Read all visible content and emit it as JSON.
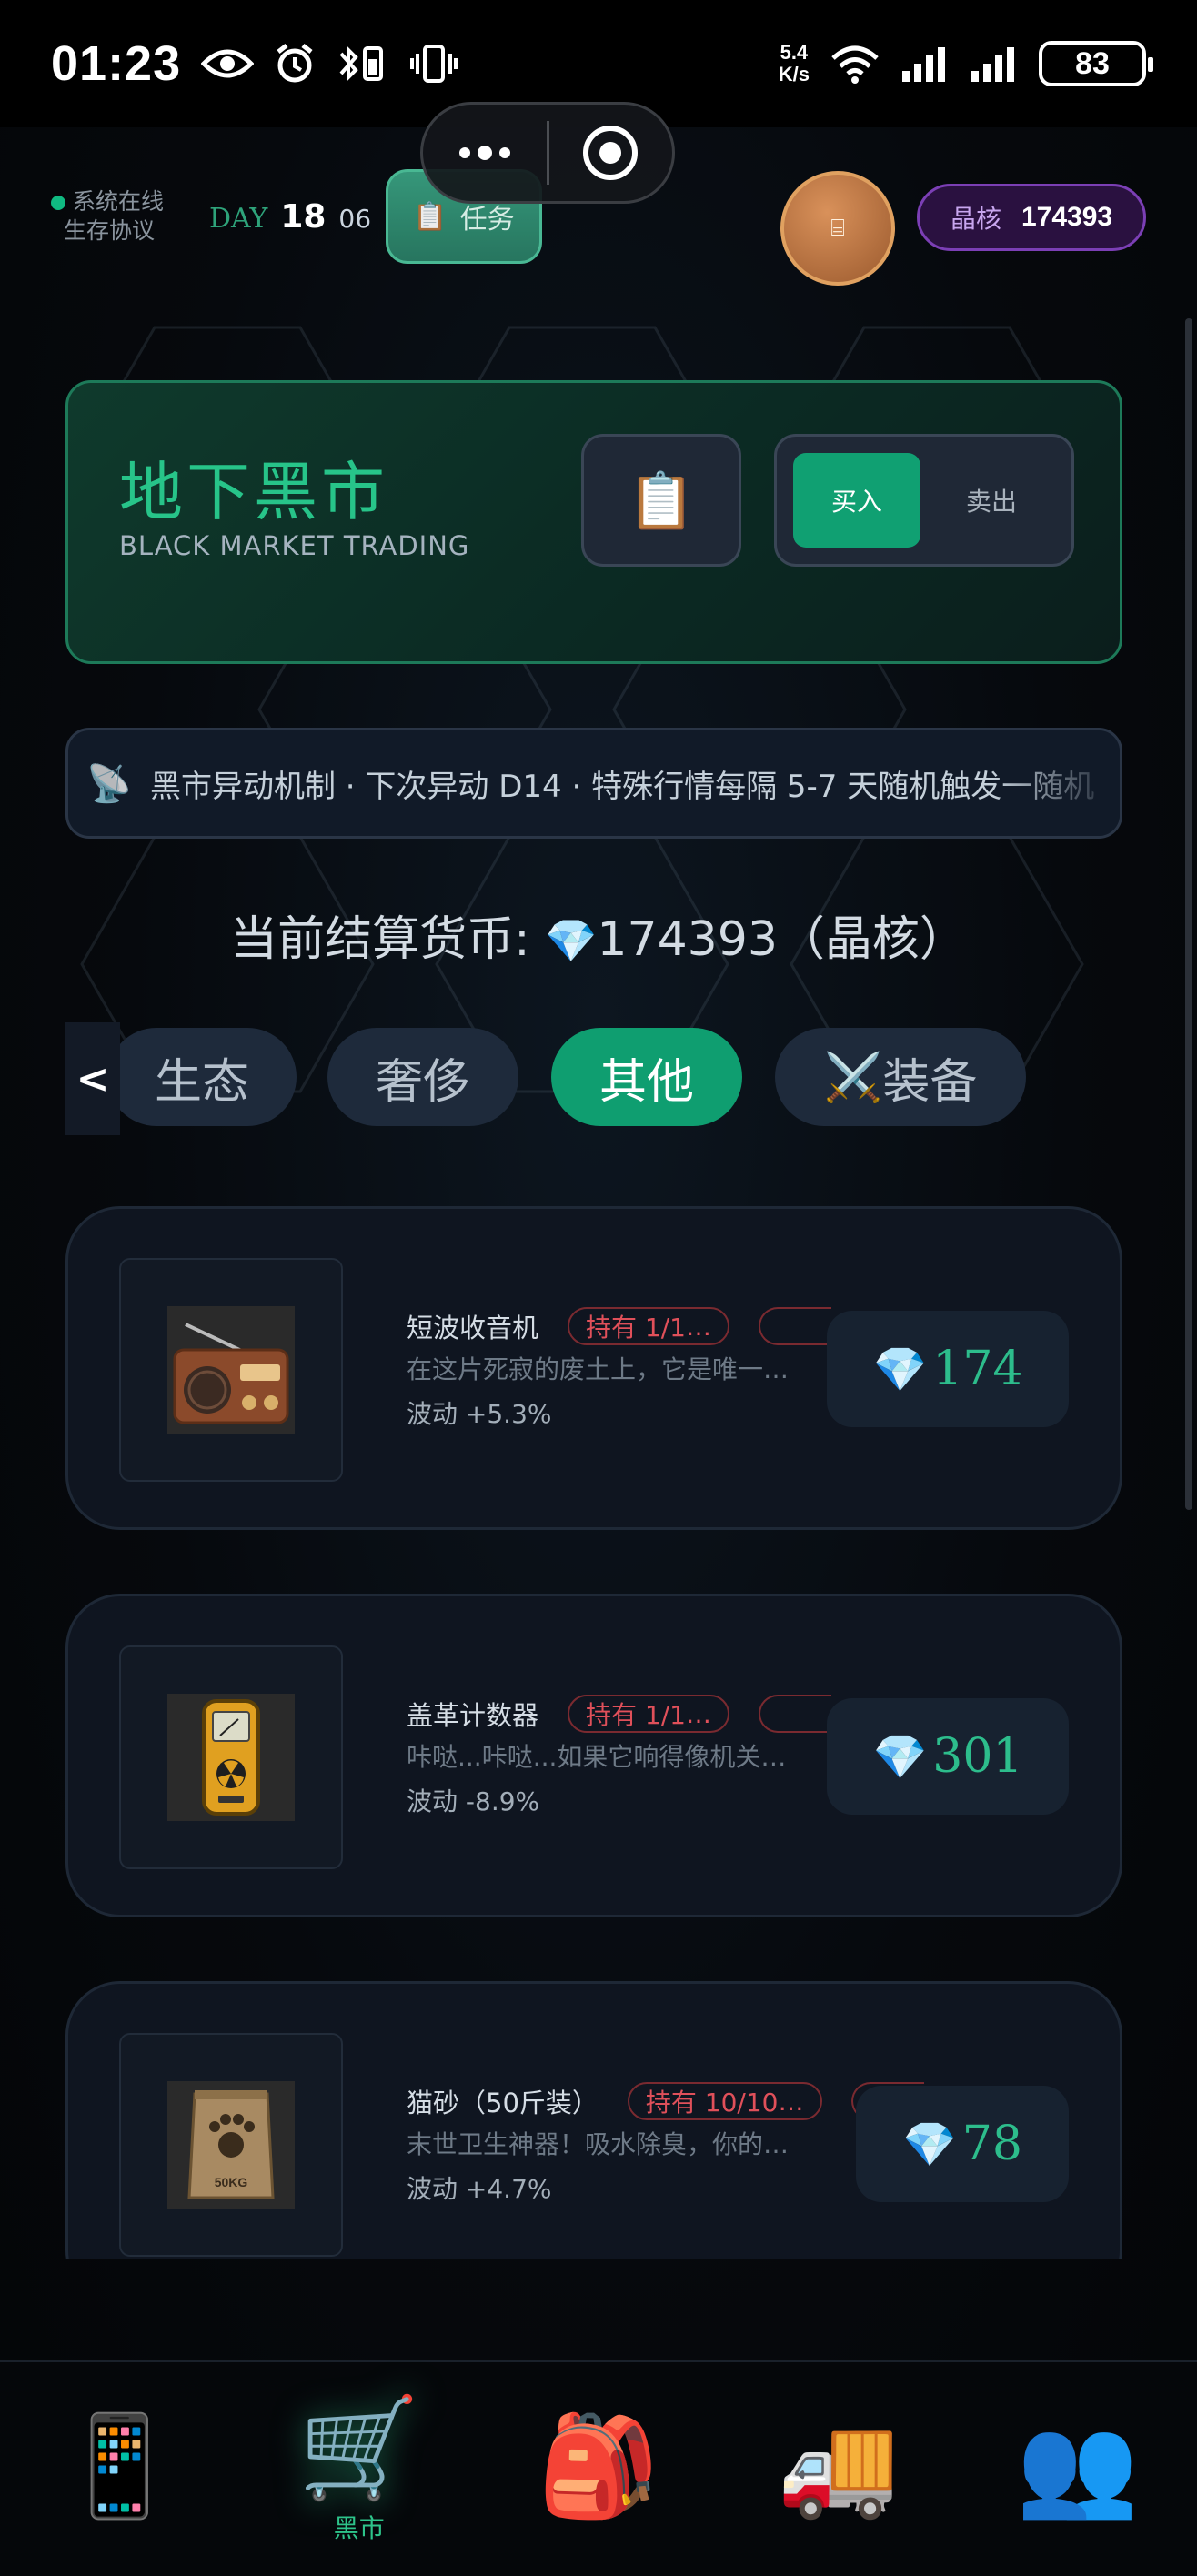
{
  "status_bar": {
    "time": "01:23",
    "net_speed_value": "5.4",
    "net_speed_unit": "K/s",
    "battery": "83"
  },
  "header": {
    "online_status": "系统在线",
    "protocol": "生存协议",
    "day_label": "DAY",
    "day_number": "18",
    "day_sub": "06",
    "task_button": "任务",
    "avatar_glyph": "⌸",
    "crystal_label": "晶核",
    "crystal_value": "174393"
  },
  "market": {
    "title": "地下黑市",
    "subtitle": "BLACK MARKET TRADING",
    "mode_buy": "买入",
    "mode_sell": "卖出",
    "active_mode": "buy"
  },
  "ticker": {
    "text": "黑市异动机制 · 下次异动 D14 · 特殊行情每隔 5-7 天随机触发一随机"
  },
  "currency": {
    "prefix": "当前结算货币:",
    "amount": "174393",
    "suffix": "（晶核）"
  },
  "tabs": {
    "back": "<",
    "items": [
      "生态",
      "奢侈",
      "其他",
      "装备"
    ],
    "active_index": 2
  },
  "items": [
    {
      "name": "短波收音机",
      "held": "持有 1/1",
      "description": "在这片死寂的废土上，它是唯一的声音来源",
      "wave": "波动 +5.3%",
      "price": "174",
      "icon": "radio-icon"
    },
    {
      "name": "盖革计数器",
      "held": "持有 1/1",
      "description": "咔哒...咔哒...如果它响得像机关枪一样，快跑",
      "wave": "波动 -8.9%",
      "price": "301",
      "icon": "geiger-counter-icon"
    },
    {
      "name": "猫砂（50斤装）",
      "held": "持有 10/10",
      "description": "末世卫生神器！吸水除臭，你的房间会感谢你",
      "wave": "波动 +4.7%",
      "price": "78",
      "icon": "cat-litter-bag-icon",
      "bag_label": "50KG"
    }
  ],
  "bottom_nav": {
    "items": [
      {
        "icon": "phone-icon",
        "label": ""
      },
      {
        "icon": "cart-icon",
        "label": "黑市"
      },
      {
        "icon": "backpack-icon",
        "label": ""
      },
      {
        "icon": "truck-icon",
        "label": ""
      },
      {
        "icon": "people-icon",
        "label": ""
      }
    ],
    "active_index": 1
  },
  "colors": {
    "accent_green": "#10a072",
    "price_green": "#2dbd8c",
    "held_red": "#e0505a",
    "crystal_purple": "#7b3fb5"
  }
}
